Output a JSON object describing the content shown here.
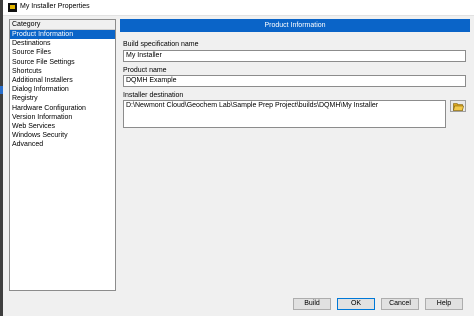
{
  "window": {
    "title": "My Installer Properties"
  },
  "category_list": {
    "header": "Category",
    "items": [
      "Product Information",
      "Destinations",
      "Source Files",
      "Source File Settings",
      "Shortcuts",
      "Additional Installers",
      "Dialog Information",
      "Registry",
      "Hardware Configuration",
      "Version Information",
      "Web Services",
      "Windows Security",
      "Advanced"
    ],
    "selected_index": 0
  },
  "panel": {
    "header": "Product Information",
    "build_spec_label": "Build specification name",
    "build_spec_value": "My Installer",
    "product_name_label": "Product name",
    "product_name_value": "DQMH Example",
    "installer_dest_label": "Installer destination",
    "installer_dest_value": "D:\\Newmont Cloud\\Geochem Lab\\Sample Prep Project\\builds\\DQMH\\My Installer"
  },
  "buttons": {
    "build": "Build",
    "ok": "OK",
    "cancel": "Cancel",
    "help": "Help"
  },
  "colors": {
    "accent": "#0a64c8"
  }
}
